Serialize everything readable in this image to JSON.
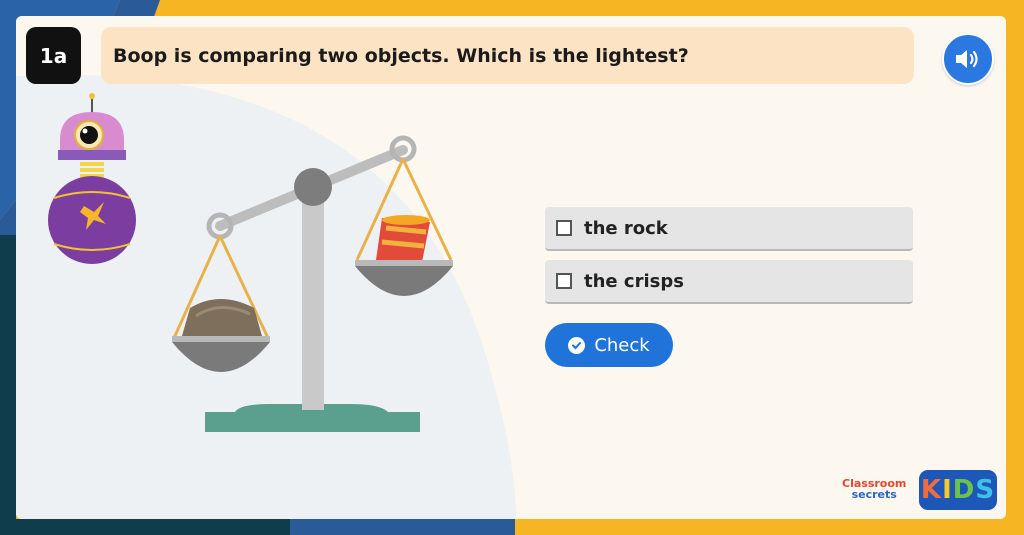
{
  "question": {
    "number": "1a",
    "text": "Boop is comparing two objects. Which is the lightest?"
  },
  "audio": {
    "icon": "speaker-icon"
  },
  "options": [
    {
      "label": "the rock",
      "checked": false
    },
    {
      "label": "the crisps",
      "checked": false
    }
  ],
  "check_button": {
    "label": "Check"
  },
  "logo": {
    "line1": "Classroom",
    "line2": "secrets",
    "kids": [
      "K",
      "I",
      "D",
      "S"
    ]
  },
  "colors": {
    "accent_blue": "#1f73d9",
    "frame_yellow": "#f6b623",
    "question_bg": "#fbe3c4"
  }
}
